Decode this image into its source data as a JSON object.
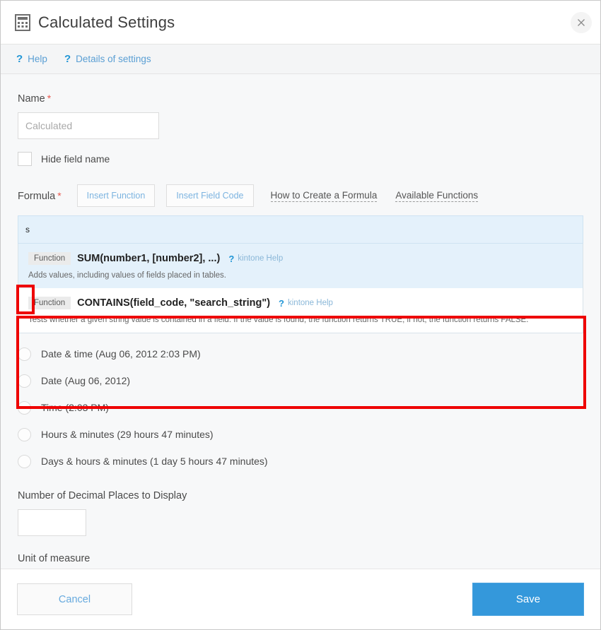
{
  "header": {
    "title": "Calculated Settings",
    "icon": "calculator-icon",
    "close_icon": "close-icon"
  },
  "helpbar": {
    "links": [
      {
        "label": "Help",
        "icon": "question-mark-icon"
      },
      {
        "label": "Details of settings",
        "icon": "question-mark-icon"
      }
    ]
  },
  "form": {
    "name": {
      "label": "Name",
      "required_marker": "*",
      "placeholder": "Calculated",
      "value": ""
    },
    "hide_field_name": {
      "label": "Hide field name",
      "checked": false
    },
    "formula": {
      "label": "Formula",
      "required_marker": "*",
      "insert_function_label": "Insert Function",
      "insert_field_code_label": "Insert Field Code",
      "how_to_link": "How to Create a Formula",
      "available_functions_link": "Available Functions",
      "input_value": "s"
    },
    "autocomplete": {
      "items": [
        {
          "badge": "Function",
          "signature": "SUM(number1, [number2], ...)",
          "help_label": "kintone Help",
          "description": "Adds values, including values of fields placed in tables.",
          "selected": true
        },
        {
          "badge": "Function",
          "signature": "CONTAINS(field_code, \"search_string\")",
          "help_label": "kintone Help",
          "description": "Tests whether a given string value is contained in a field. If the value is found, the function returns TRUE; if not, the function returns FALSE.",
          "selected": false
        }
      ]
    },
    "display_format": {
      "options": [
        {
          "label": "Date & time (Aug 06, 2012 2:03 PM)",
          "checked": false
        },
        {
          "label": "Date (Aug 06, 2012)",
          "checked": false
        },
        {
          "label": "Time (2:03 PM)",
          "checked": false
        },
        {
          "label": "Hours & minutes (29 hours 47 minutes)",
          "checked": false
        },
        {
          "label": "Days & hours & minutes (1 day 5 hours 47 minutes)",
          "checked": false
        }
      ]
    },
    "decimal_places": {
      "label": "Number of Decimal Places to Display",
      "value": ""
    },
    "unit_of_measure": {
      "label": "Unit of measure",
      "value": ""
    }
  },
  "footer": {
    "cancel_label": "Cancel",
    "save_label": "Save"
  },
  "colors": {
    "accent": "#3498db",
    "link": "#5a9fd4",
    "required": "#e8584f",
    "annotation": "#ee0000",
    "selected_row": "#e4f1fb"
  }
}
